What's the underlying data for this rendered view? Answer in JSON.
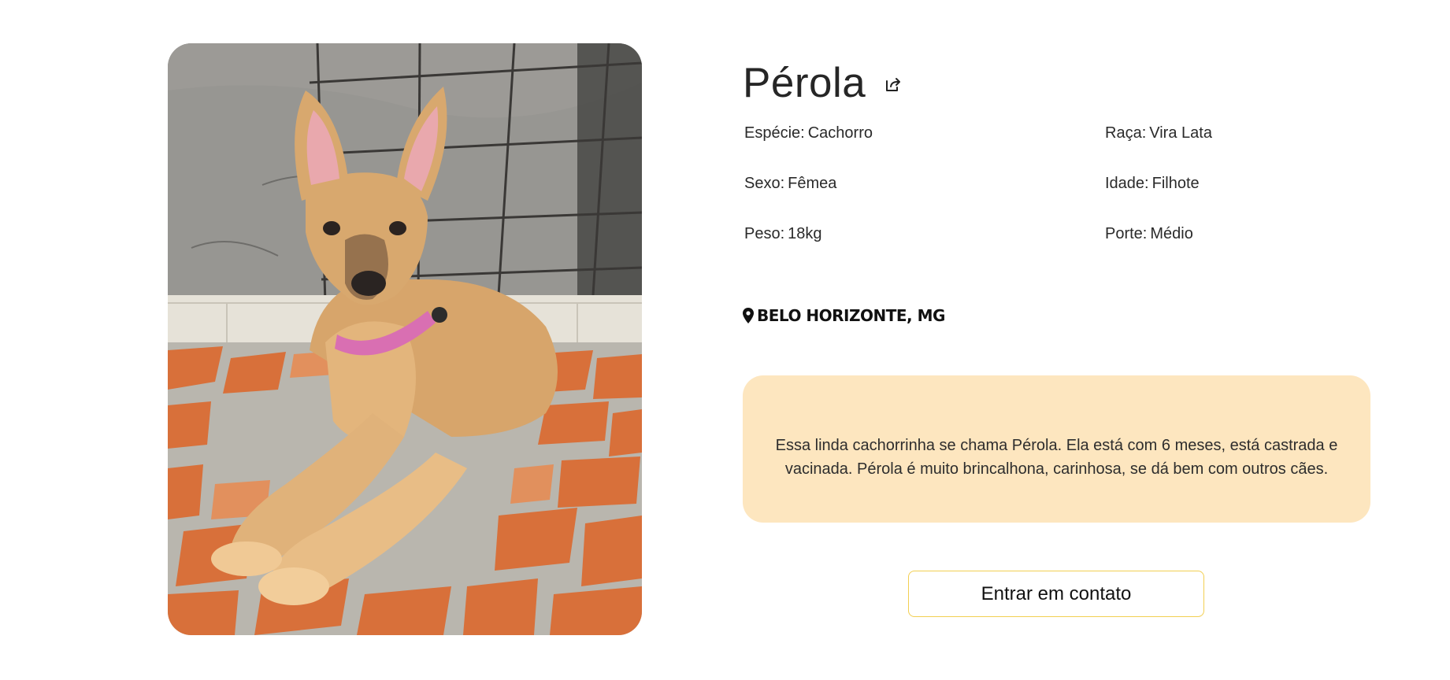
{
  "pet": {
    "name": "Pérola",
    "photo_alt": "Pérola",
    "attributes": [
      {
        "key": "Espécie:",
        "value": "Cachorro"
      },
      {
        "key": "Raça:",
        "value": "Vira Lata"
      },
      {
        "key": "Sexo:",
        "value": "Fêmea"
      },
      {
        "key": "Idade:",
        "value": "Filhote"
      },
      {
        "key": "Peso:",
        "value": "18kg"
      },
      {
        "key": "Porte:",
        "value": "Médio"
      }
    ],
    "location": "BELO HORIZONTE, MG",
    "description": "Essa linda cachorrinha se chama Pérola. Ela está com 6 meses, está castrada e vacinada. Pérola é muito brincalhona, carinhosa, se dá bem com outros cães."
  },
  "actions": {
    "share_icon": "share-icon",
    "contact_label": "Entrar em contato"
  },
  "colors": {
    "description_bg": "#fde6bf",
    "button_border": "#f2cf52",
    "text": "#222222"
  }
}
